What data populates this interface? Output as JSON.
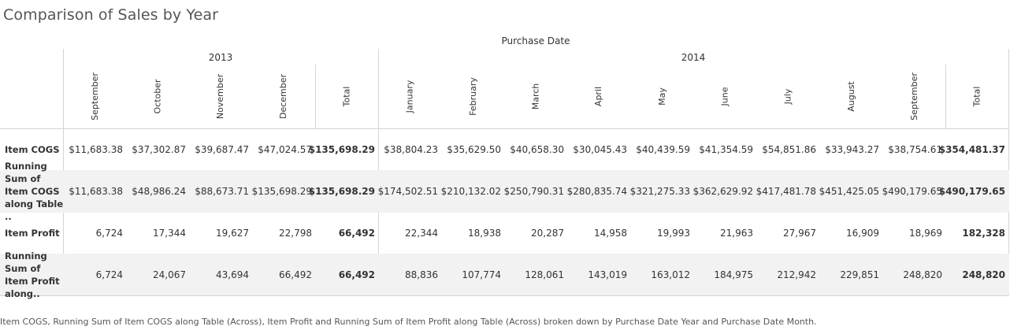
{
  "title": "Comparison of Sales by Year",
  "column_field_label": "Purchase Date",
  "years": [
    "2013",
    "2014"
  ],
  "months": [
    "September",
    "October",
    "November",
    "December",
    "Total",
    "January",
    "February",
    "March",
    "April",
    "May",
    "June",
    "July",
    "August",
    "September",
    "Total"
  ],
  "rows": [
    {
      "label": "Item COGS",
      "values": [
        "$11,683.38",
        "$37,302.87",
        "$39,687.47",
        "$47,024.57",
        "$135,698.29",
        "$38,804.23",
        "$35,629.50",
        "$40,658.30",
        "$30,045.43",
        "$40,439.59",
        "$41,354.59",
        "$54,851.86",
        "$33,943.27",
        "$38,754.61",
        "$354,481.37"
      ]
    },
    {
      "label": "Running Sum of Item COGS along Table ..",
      "values": [
        "$11,683.38",
        "$48,986.24",
        "$88,673.71",
        "$135,698.29",
        "$135,698.29",
        "$174,502.51",
        "$210,132.02",
        "$250,790.31",
        "$280,835.74",
        "$321,275.33",
        "$362,629.92",
        "$417,481.78",
        "$451,425.05",
        "$490,179.65",
        "$490,179.65"
      ]
    },
    {
      "label": "Item Profit",
      "values": [
        "6,724",
        "17,344",
        "19,627",
        "22,798",
        "66,492",
        "22,344",
        "18,938",
        "20,287",
        "14,958",
        "19,993",
        "21,963",
        "27,967",
        "16,909",
        "18,969",
        "182,328"
      ]
    },
    {
      "label": "Running Sum of Item Profit along..",
      "values": [
        "6,724",
        "24,067",
        "43,694",
        "66,492",
        "66,492",
        "88,836",
        "107,774",
        "128,061",
        "143,019",
        "163,012",
        "184,975",
        "212,942",
        "229,851",
        "248,820",
        "248,820"
      ]
    }
  ],
  "footnote": "Item COGS, Running Sum of Item COGS along Table (Across), Item Profit and Running Sum of Item Profit along Table (Across) broken down by Purchase Date Year and Purchase Date Month.",
  "chart_data": {
    "type": "table",
    "title": "Comparison of Sales by Year",
    "column_header": "Purchase Date",
    "columns": [
      {
        "year": "2013",
        "month": "September"
      },
      {
        "year": "2013",
        "month": "October"
      },
      {
        "year": "2013",
        "month": "November"
      },
      {
        "year": "2013",
        "month": "December"
      },
      {
        "year": "2013",
        "month": "Total"
      },
      {
        "year": "2014",
        "month": "January"
      },
      {
        "year": "2014",
        "month": "February"
      },
      {
        "year": "2014",
        "month": "March"
      },
      {
        "year": "2014",
        "month": "April"
      },
      {
        "year": "2014",
        "month": "May"
      },
      {
        "year": "2014",
        "month": "June"
      },
      {
        "year": "2014",
        "month": "July"
      },
      {
        "year": "2014",
        "month": "August"
      },
      {
        "year": "2014",
        "month": "September"
      },
      {
        "year": "2014",
        "month": "Total"
      }
    ],
    "series": [
      {
        "name": "Item COGS",
        "values": [
          11683.38,
          37302.87,
          39687.47,
          47024.57,
          135698.29,
          38804.23,
          35629.5,
          40658.3,
          30045.43,
          40439.59,
          41354.59,
          54851.86,
          33943.27,
          38754.61,
          354481.37
        ]
      },
      {
        "name": "Running Sum of Item COGS along Table ..",
        "values": [
          11683.38,
          48986.24,
          88673.71,
          135698.29,
          135698.29,
          174502.51,
          210132.02,
          250790.31,
          280835.74,
          321275.33,
          362629.92,
          417481.78,
          451425.05,
          490179.65,
          490179.65
        ]
      },
      {
        "name": "Item Profit",
        "values": [
          6724,
          17344,
          19627,
          22798,
          66492,
          22344,
          18938,
          20287,
          14958,
          19993,
          21963,
          27967,
          16909,
          18969,
          182328
        ]
      },
      {
        "name": "Running Sum of Item Profit along..",
        "values": [
          6724,
          24067,
          43694,
          66492,
          66492,
          88836,
          107774,
          128061,
          143019,
          163012,
          184975,
          212942,
          229851,
          248820,
          248820
        ]
      }
    ]
  }
}
